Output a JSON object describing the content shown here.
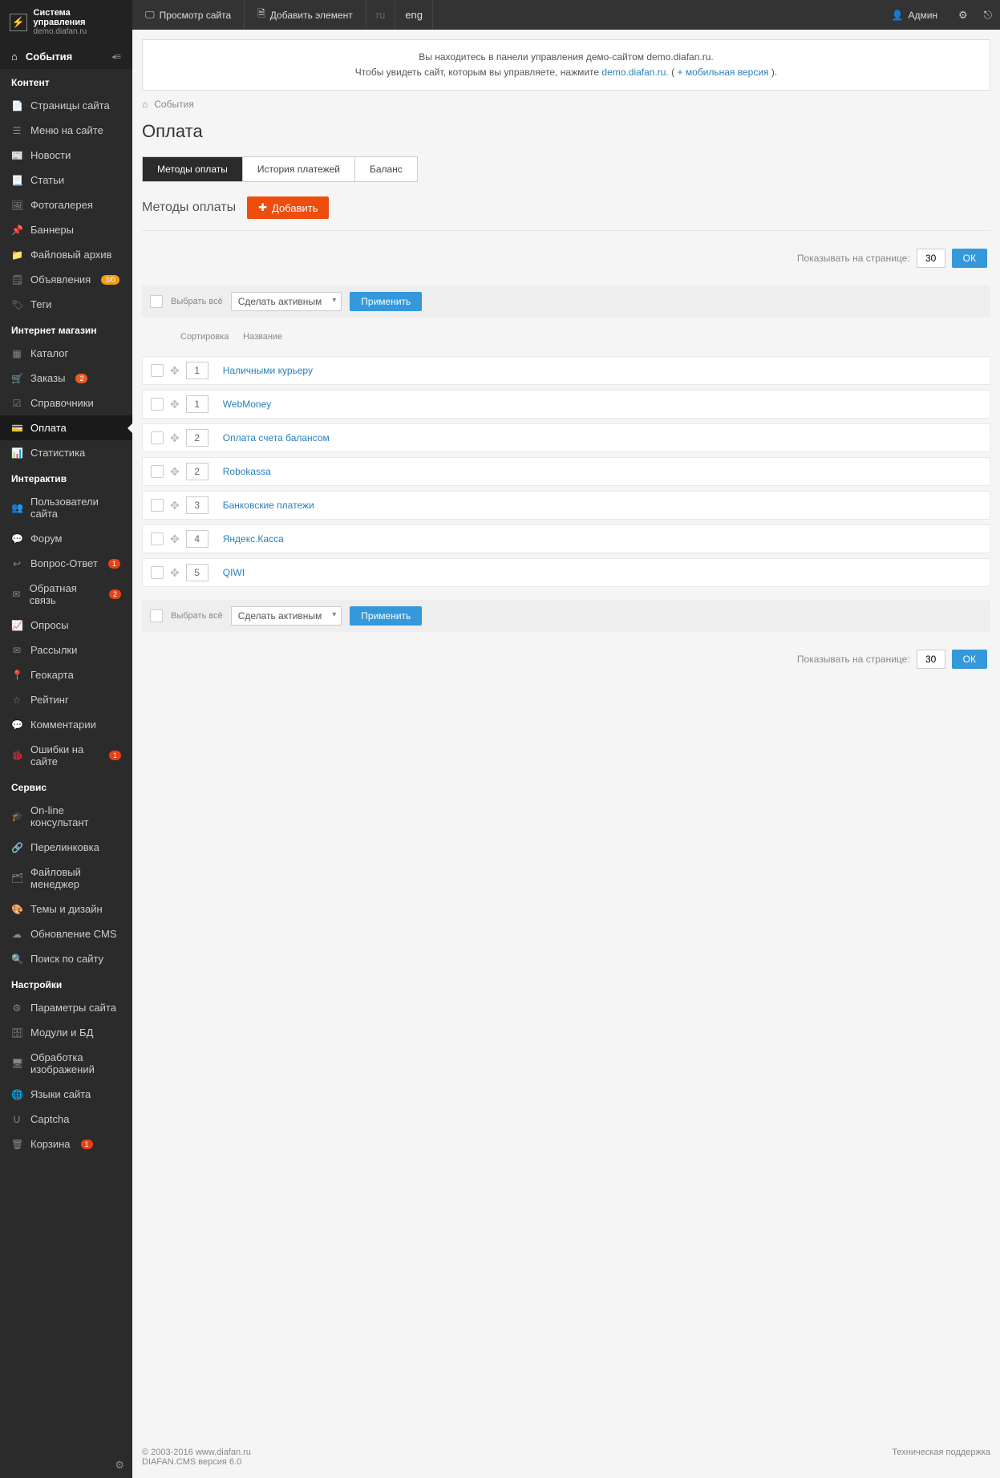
{
  "header": {
    "system_title": "Система управления",
    "domain": "demo.diafan.ru",
    "view_site": "Просмотр сайта",
    "add_element": "Добавить элемент",
    "lang_ru": "ru",
    "lang_eng": "eng",
    "admin": "Админ"
  },
  "sidebar": {
    "events": "События",
    "groups": [
      {
        "title": "Контент",
        "items": [
          {
            "label": "Страницы сайта",
            "icon": "📄"
          },
          {
            "label": "Меню на сайте",
            "icon": "☰"
          },
          {
            "label": "Новости",
            "icon": "📰"
          },
          {
            "label": "Статьи",
            "icon": "📃"
          },
          {
            "label": "Фотогалерея",
            "icon": "🖼"
          },
          {
            "label": "Баннеры",
            "icon": "📌"
          },
          {
            "label": "Файловый архив",
            "icon": "📁"
          },
          {
            "label": "Объявления",
            "icon": "🗒",
            "badge": "3/0",
            "badge_class": "yellow"
          },
          {
            "label": "Теги",
            "icon": "🏷"
          }
        ]
      },
      {
        "title": "Интернет магазин",
        "items": [
          {
            "label": "Каталог",
            "icon": "▦"
          },
          {
            "label": "Заказы",
            "icon": "🛒",
            "badge": "2"
          },
          {
            "label": "Справочники",
            "icon": "☑"
          },
          {
            "label": "Оплата",
            "icon": "💳",
            "active": true
          },
          {
            "label": "Статистика",
            "icon": "📊"
          }
        ]
      },
      {
        "title": "Интерактив",
        "items": [
          {
            "label": "Пользователи сайта",
            "icon": "👥"
          },
          {
            "label": "Форум",
            "icon": "💬"
          },
          {
            "label": "Вопрос-Ответ",
            "icon": "↩",
            "badge": "1",
            "badge_class": "red"
          },
          {
            "label": "Обратная связь",
            "icon": "✉",
            "badge": "2",
            "badge_class": "red"
          },
          {
            "label": "Опросы",
            "icon": "📈"
          },
          {
            "label": "Рассылки",
            "icon": "✉"
          },
          {
            "label": "Геокарта",
            "icon": "📍"
          },
          {
            "label": "Рейтинг",
            "icon": "☆"
          },
          {
            "label": "Комментарии",
            "icon": "💬"
          },
          {
            "label": "Ошибки на сайте",
            "icon": "🐞",
            "badge": "1",
            "badge_class": "red"
          }
        ]
      },
      {
        "title": "Сервис",
        "items": [
          {
            "label": "On-line консультант",
            "icon": "🎓"
          },
          {
            "label": "Перелинковка",
            "icon": "🔗"
          },
          {
            "label": "Файловый менеджер",
            "icon": "🗂"
          },
          {
            "label": "Темы и дизайн",
            "icon": "🎨"
          },
          {
            "label": "Обновление CMS",
            "icon": "☁"
          },
          {
            "label": "Поиск по сайту",
            "icon": "🔍"
          }
        ]
      },
      {
        "title": "Настройки",
        "items": [
          {
            "label": "Параметры сайта",
            "icon": "⚙"
          },
          {
            "label": "Модули и БД",
            "icon": "🗄"
          },
          {
            "label": "Обработка изображений",
            "icon": "🖥"
          },
          {
            "label": "Языки сайта",
            "icon": "🌐"
          },
          {
            "label": "Captcha",
            "icon": "U"
          },
          {
            "label": "Корзина",
            "icon": "🗑",
            "badge": "1",
            "badge_class": "red"
          }
        ]
      }
    ]
  },
  "notice": {
    "line1": "Вы находитесь в панели управления демо-сайтом demo.diafan.ru.",
    "line2_a": "Чтобы увидеть сайт, которым вы управляете, нажмите ",
    "line2_link": "demo.diafan.ru.",
    "line2_b": " (",
    "line2_link2": "+ мобильная версия",
    "line2_c": ")."
  },
  "breadcrumb": {
    "home": "⌂",
    "current": "События"
  },
  "page": {
    "title": "Оплата"
  },
  "tabs": [
    {
      "label": "Методы оплаты",
      "active": true
    },
    {
      "label": "История платежей"
    },
    {
      "label": "Баланс"
    }
  ],
  "methods": {
    "heading": "Методы оплаты",
    "add_button": "Добавить"
  },
  "perpage": {
    "label": "Показывать на странице:",
    "value": "30",
    "ok": "ОК"
  },
  "bulk": {
    "select_all": "Выбрать всё",
    "action": "Сделать активным",
    "apply": "Применить"
  },
  "columns": {
    "sort": "Сортировка",
    "name": "Название"
  },
  "rows": [
    {
      "sort": "1",
      "name": "Наличными курьеру"
    },
    {
      "sort": "1",
      "name": "WebMoney"
    },
    {
      "sort": "2",
      "name": "Оплата счета балансом"
    },
    {
      "sort": "2",
      "name": "Robokassa"
    },
    {
      "sort": "3",
      "name": "Банковские платежи"
    },
    {
      "sort": "4",
      "name": "Яндекс.Касса"
    },
    {
      "sort": "5",
      "name": "QIWI"
    }
  ],
  "footer": {
    "copyright": "© 2003-2016 www.diafan.ru",
    "version": "DIAFAN.CMS версия 6.0",
    "support": "Техническая поддержка"
  }
}
